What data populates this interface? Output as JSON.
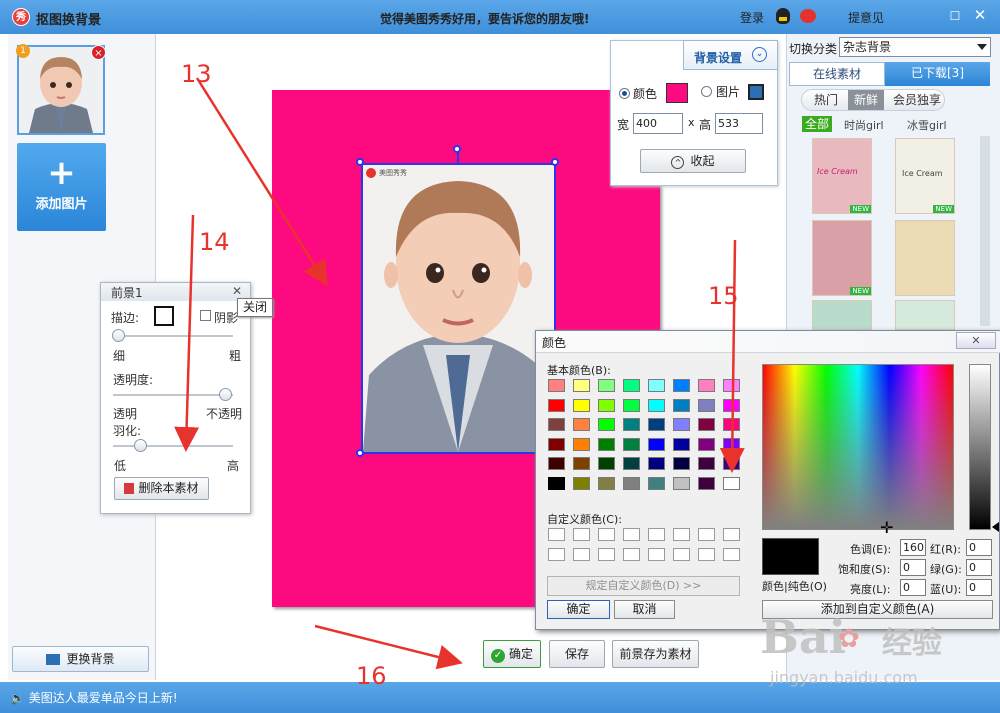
{
  "window": {
    "title": "抠图换背景",
    "logo": "秀",
    "slogan": "觉得美图秀秀好用，要告诉您的朋友哦!",
    "login": "登录",
    "feedback": "提意见",
    "minimize_glyph": "☐",
    "close_glyph": "✕"
  },
  "left_panel": {
    "thumb_badge": "1",
    "remove_glyph": "×",
    "add_button_icon": "+",
    "add_button": "添加图片",
    "swap_background": "更换背景"
  },
  "statusbar": {
    "message": "美图达人最爱单品今日上新!"
  },
  "stage": {
    "background_color": "#fe0a80",
    "logo_mark": "美图秀秀"
  },
  "bg_settings": {
    "tab_label": "背景设置",
    "chevron": "⌄",
    "option_color": "颜色",
    "option_image": "图片",
    "width_label": "宽",
    "width_value": "400",
    "times": "x",
    "height_label": "高",
    "height_value": "533",
    "collapse_icon": "^",
    "collapse": "收起"
  },
  "right_panel": {
    "category_label": "切换分类",
    "category_value": "杂志背景",
    "tab_online": "在线素材",
    "tab_downloaded": "已下载[3]",
    "sub_hot": "热门",
    "sub_new": "新鲜",
    "sub_member": "会员独享",
    "filter_all": "全部",
    "filter_1": "时尚girl",
    "filter_2": "冰雪girl",
    "new_badge": "NEW",
    "card_text": [
      "Ice Cream",
      "Ice Cream",
      "",
      "",
      "",
      ""
    ]
  },
  "fg_panel": {
    "title": "前景1",
    "close_glyph": "✕",
    "tooltip": "关闭",
    "border_label": "描边:",
    "shadow_label": "阴影",
    "thin": "细",
    "thick": "粗",
    "opacity_label": "透明度:",
    "transparent": "透明",
    "opaque": "不透明",
    "feather_label": "羽化:",
    "low": "低",
    "high": "高",
    "delete": "删除本素材"
  },
  "bottom_buttons": {
    "ok_glyph": "✓",
    "ok": "确定",
    "save": "保存",
    "save_fg": "前景存为素材"
  },
  "color_dialog": {
    "title": "颜色",
    "close_glyph": "✕",
    "basic_colors_label": "基本颜色(B):",
    "custom_colors_label": "自定义颜色(C):",
    "define_custom": "规定自定义颜色(D) >>",
    "ok": "确定",
    "cancel": "取消",
    "color_solid": "颜色|纯色(O)",
    "hue_label": "色调(E):",
    "hue": "160",
    "sat_label": "饱和度(S):",
    "sat": "0",
    "lum_label": "亮度(L):",
    "lum": "0",
    "red_label": "红(R):",
    "red": "0",
    "green_label": "绿(G):",
    "green": "0",
    "blue_label": "蓝(U):",
    "blue": "0",
    "add_custom": "添加到自定义颜色(A)",
    "basic_colors": [
      "#ff8080",
      "#ffff80",
      "#80ff80",
      "#00ff80",
      "#80ffff",
      "#0080ff",
      "#ff80c0",
      "#ff80ff",
      "#ff0000",
      "#ffff00",
      "#80ff00",
      "#00ff40",
      "#00ffff",
      "#0080c0",
      "#8080c0",
      "#ff00ff",
      "#804040",
      "#ff8040",
      "#00ff00",
      "#008080",
      "#004080",
      "#8080ff",
      "#800040",
      "#ff0080",
      "#800000",
      "#ff8000",
      "#008000",
      "#008040",
      "#0000ff",
      "#0000a0",
      "#800080",
      "#8000ff",
      "#400000",
      "#804000",
      "#004000",
      "#004040",
      "#000080",
      "#000040",
      "#400040",
      "#400080",
      "#000000",
      "#808000",
      "#808040",
      "#808080",
      "#408080",
      "#c0c0c0",
      "#400040",
      "#ffffff"
    ]
  },
  "annotations": {
    "a13": "13",
    "a14": "14",
    "a15": "15",
    "a16": "16"
  },
  "watermark": {
    "brand": "Bai",
    "brand_cn": "经验",
    "url": "jingyan.baidu.com"
  },
  "colors": {
    "accent": "#3f8fd9",
    "canvas_bg": "#fe0a80",
    "selection": "#2e34e8",
    "annotation": "#e8332d"
  }
}
